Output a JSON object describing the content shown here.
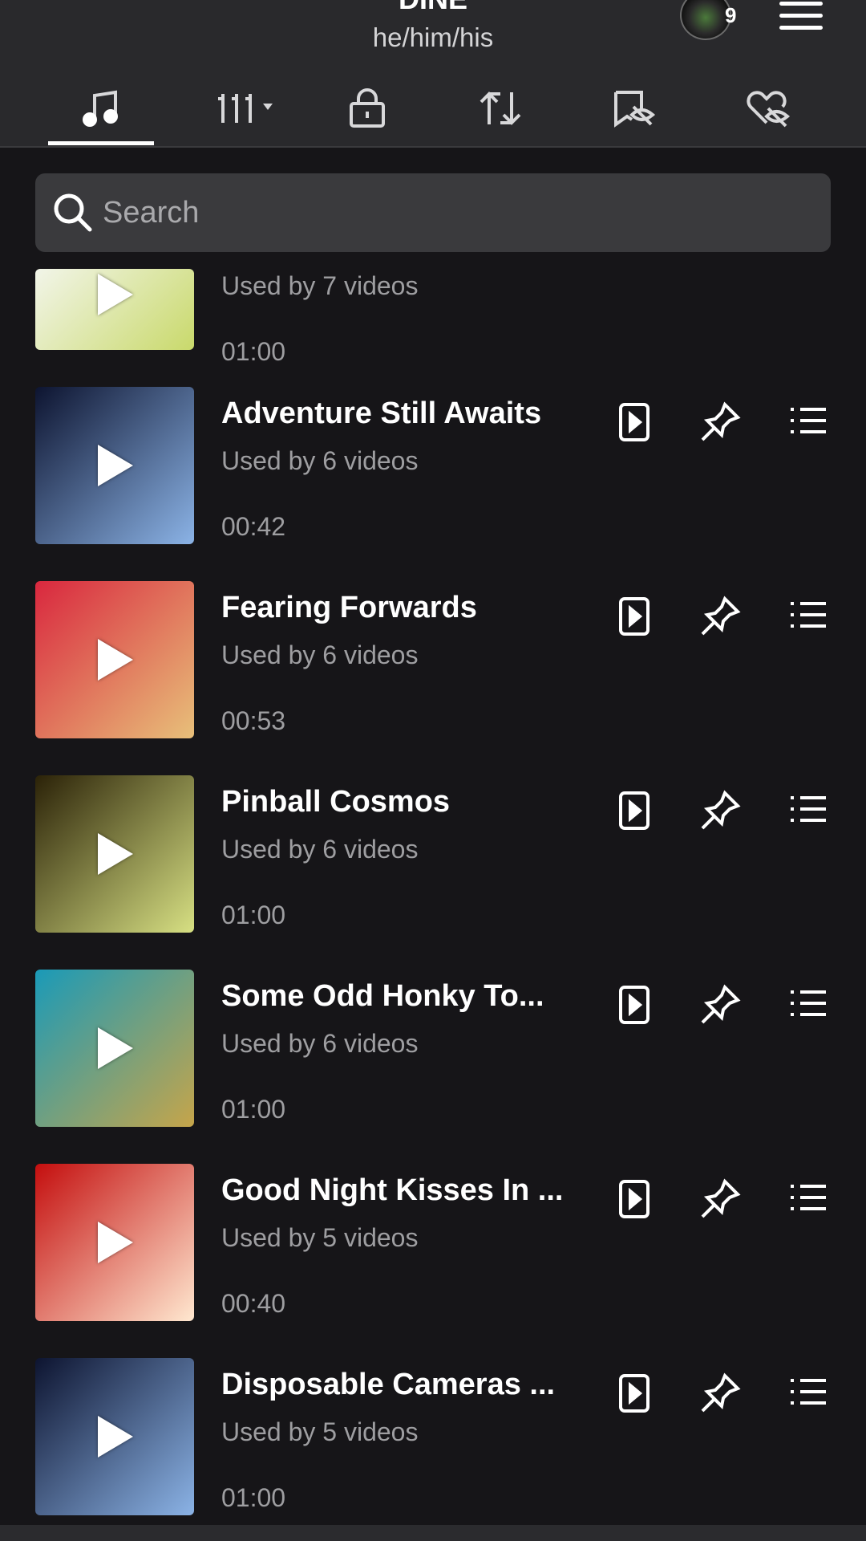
{
  "profile": {
    "username": "DINE",
    "pronouns": "he/him/his",
    "notification_count": "9"
  },
  "tabs": [
    {
      "name": "music-note-icon"
    },
    {
      "name": "grid-dropdown-icon"
    },
    {
      "name": "lock-icon"
    },
    {
      "name": "repost-icon"
    },
    {
      "name": "hidden-bookmark-icon"
    },
    {
      "name": "hidden-heart-icon"
    }
  ],
  "search": {
    "placeholder": "Search"
  },
  "sounds": [
    {
      "title": "",
      "used": "Used by 7 videos",
      "duration": "01:00",
      "thumb_colors": [
        "#f2f5e9",
        "#c9d96b"
      ]
    },
    {
      "title": "Adventure Still Awaits",
      "used": "Used by 6 videos",
      "duration": "00:42",
      "thumb_colors": [
        "#0d1430",
        "#8bb3e6"
      ]
    },
    {
      "title": "Fearing Forwards",
      "used": "Used by 6 videos",
      "duration": "00:53",
      "thumb_colors": [
        "#d9273e",
        "#e8c07a"
      ]
    },
    {
      "title": "Pinball Cosmos",
      "used": "Used by 6 videos",
      "duration": "01:00",
      "thumb_colors": [
        "#2b2208",
        "#d7e083"
      ]
    },
    {
      "title": "Some Odd Honky To...",
      "used": "Used by 6 videos",
      "duration": "01:00",
      "thumb_colors": [
        "#1a9ab8",
        "#c6a54a"
      ]
    },
    {
      "title": "Good Night Kisses In ...",
      "used": "Used by 5 videos",
      "duration": "00:40",
      "thumb_colors": [
        "#c40e0e",
        "#ffe8d0"
      ]
    },
    {
      "title": "Disposable Cameras ...",
      "used": "Used by 5 videos",
      "duration": "01:00",
      "thumb_colors": [
        "#0d1430",
        "#8bb3e6"
      ]
    }
  ],
  "colors": {
    "background": "#161518",
    "header": "#29292c",
    "search_bg": "#3a3a3d",
    "secondary_text": "#9e9ea1"
  }
}
